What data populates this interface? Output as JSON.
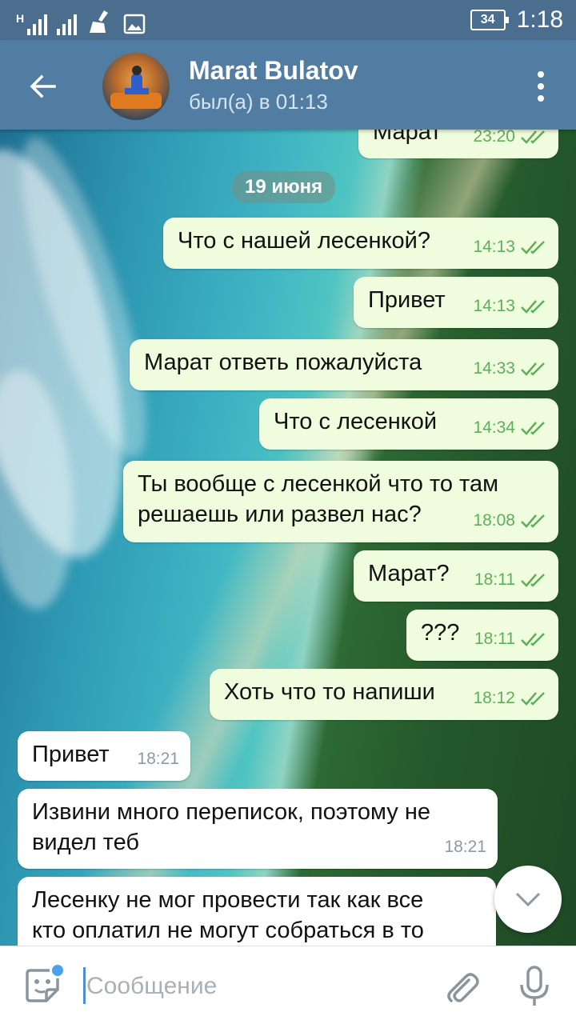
{
  "status_bar": {
    "network_letter": "H",
    "battery": "34",
    "time": "1:18"
  },
  "header": {
    "contact_name": "Marat Bulatov",
    "contact_status": "был(а) в 01:13"
  },
  "chat": {
    "partial_top": {
      "text": "Марат",
      "time": "23:20"
    },
    "date_divider": "19 июня",
    "messages": [
      {
        "dir": "out",
        "lines": [
          "Что с нашей лесенкой?"
        ],
        "time": "14:13"
      },
      {
        "dir": "out",
        "lines": [
          "Привет"
        ],
        "time": "14:13"
      },
      {
        "dir": "out",
        "lines": [
          "Марат ответь пожалуйста"
        ],
        "time": "14:33"
      },
      {
        "dir": "out",
        "lines": [
          "Что с лесенкой"
        ],
        "time": "14:34"
      },
      {
        "dir": "out",
        "lines": [
          "Ты вообще с лесенкой что то там",
          "решаешь или развел нас?"
        ],
        "time": "18:08"
      },
      {
        "dir": "out",
        "lines": [
          "Марат?"
        ],
        "time": "18:11"
      },
      {
        "dir": "out",
        "lines": [
          "???"
        ],
        "time": "18:11"
      },
      {
        "dir": "out",
        "lines": [
          "Хоть что то напиши"
        ],
        "time": "18:12"
      },
      {
        "dir": "in",
        "lines": [
          "Привет"
        ],
        "time": "18:21"
      },
      {
        "dir": "in",
        "lines": [
          "Извини много переписок, поэтому не",
          "видел теб"
        ],
        "time": "18:21"
      },
      {
        "dir": "in",
        "lines": [
          "Лесенку не мог провести так как все",
          "кто оплатил не могут собраться в то"
        ],
        "time": ""
      }
    ]
  },
  "input": {
    "placeholder": "Сообщение"
  },
  "icons": {
    "back": "arrow-left-icon",
    "menu": "more-vert-icon",
    "sticker": "sticker-icon",
    "attach": "paperclip-icon",
    "mic": "microphone-icon",
    "scroll": "chevron-down-icon"
  },
  "colors": {
    "header": "#527da3",
    "status_bar": "#4b6e8f",
    "outgoing_bubble": "#effdde",
    "incoming_bubble": "#ffffff",
    "tick": "#5faf5a"
  }
}
